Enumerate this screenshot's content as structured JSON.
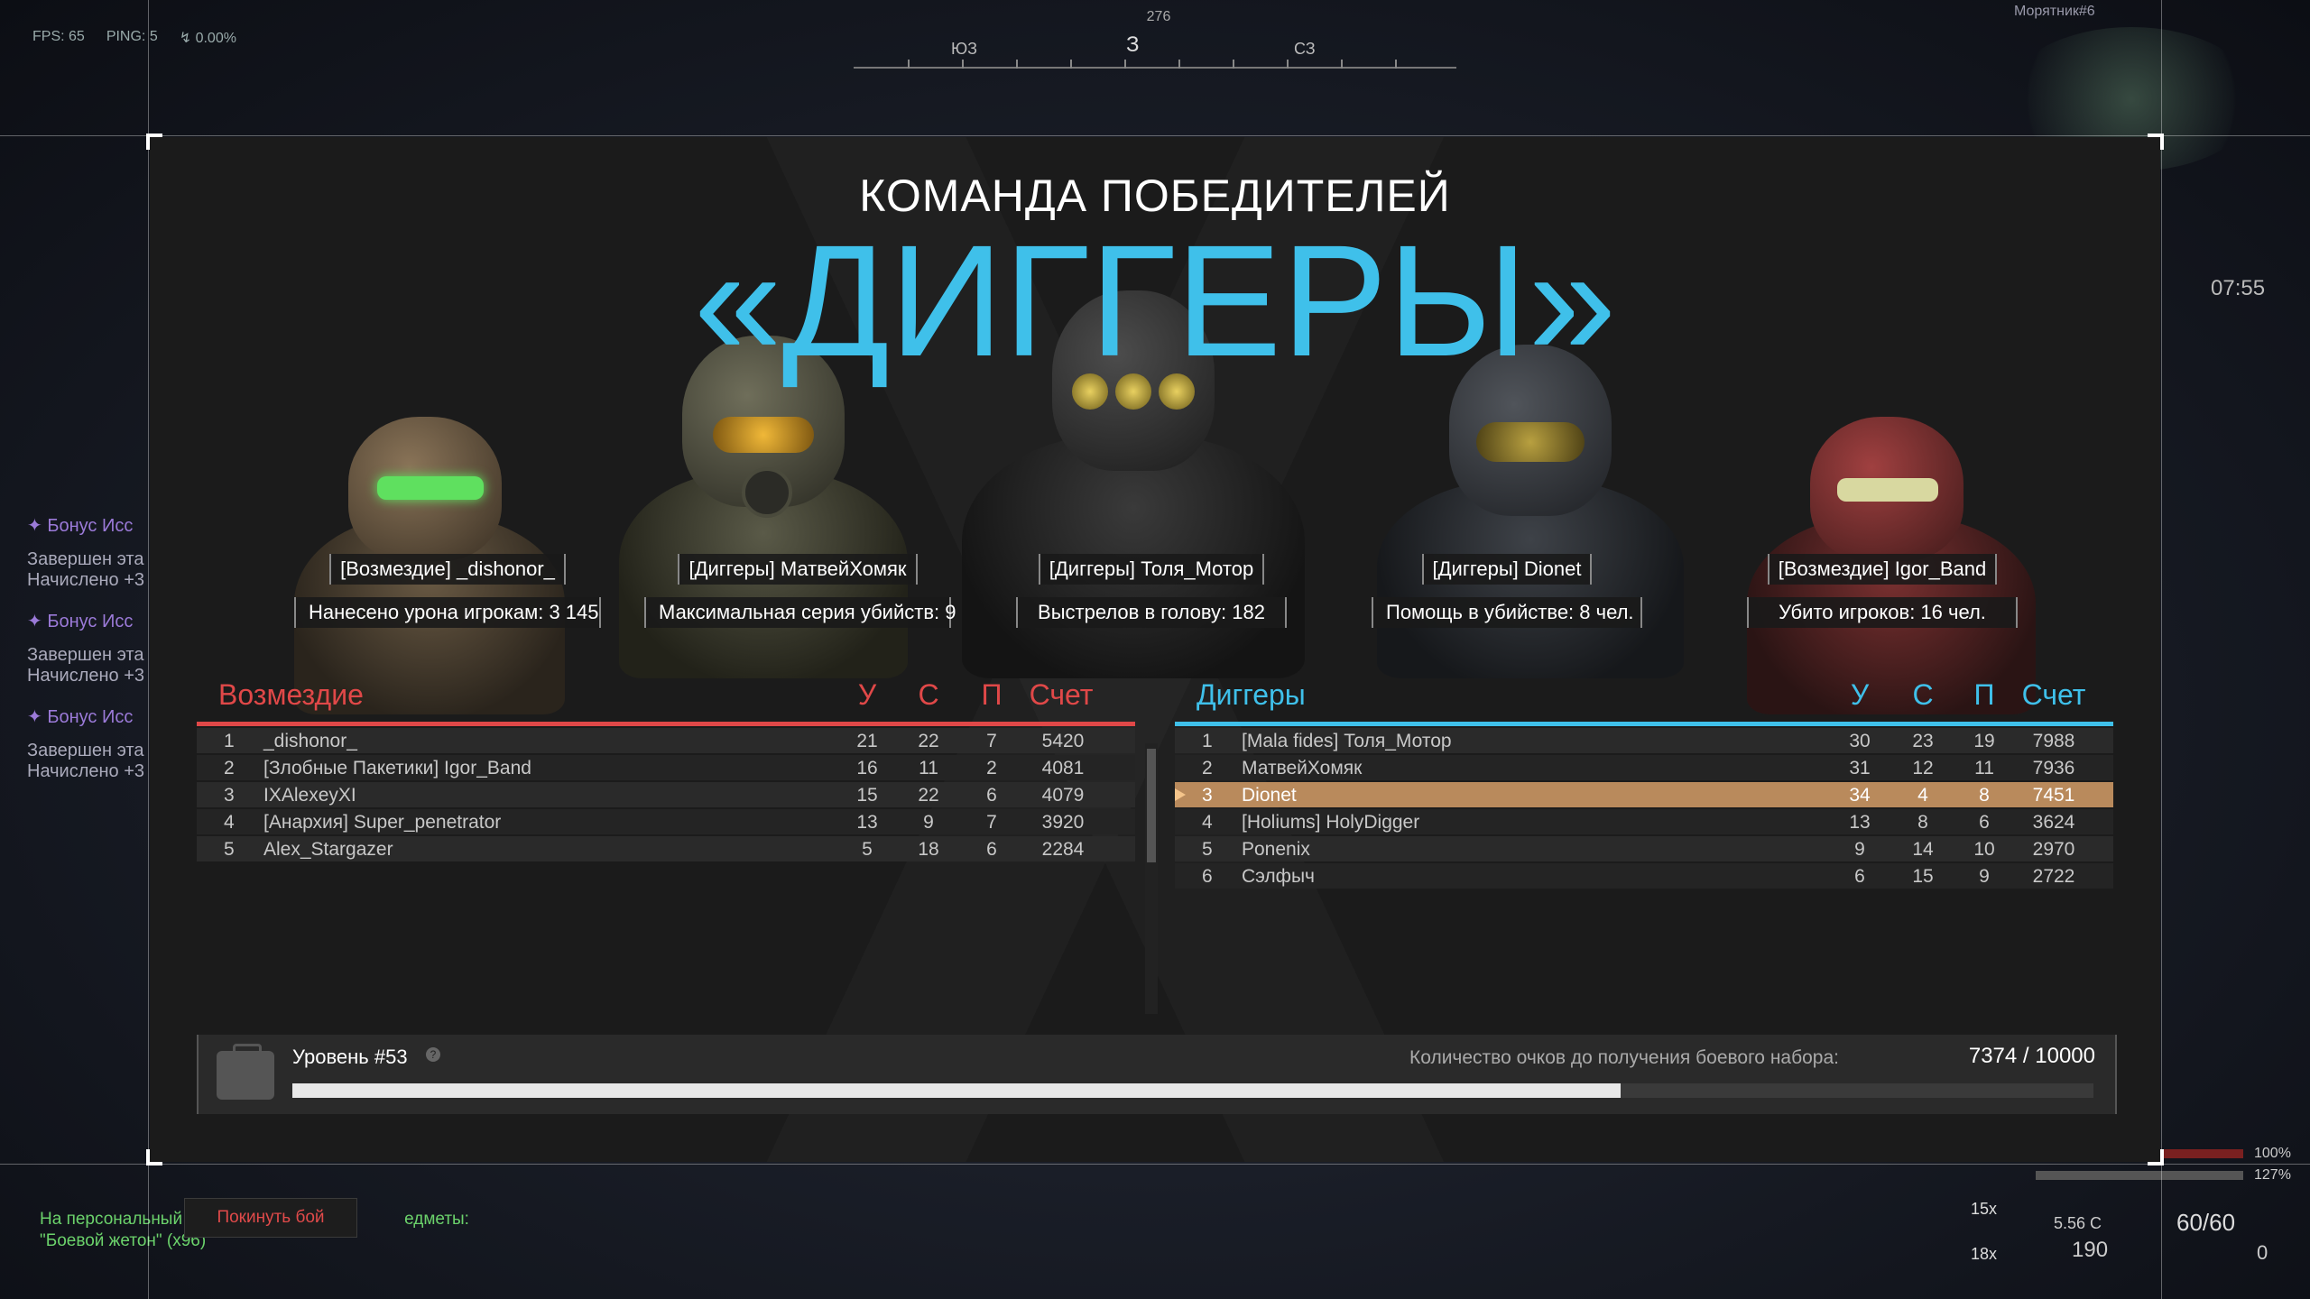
{
  "hud": {
    "fps": "FPS: 65",
    "ping": "PING: 5",
    "loss": "↯ 0.00%",
    "compass": {
      "bearing": "276",
      "main": "З",
      "left": "ЮЗ",
      "right": "СЗ"
    },
    "player_tag": "Морятник#6",
    "clock": "07:55",
    "feed": [
      {
        "bonus": "Бонус Исс",
        "line1": "Завершен эта",
        "line2": "Начислено +3"
      },
      {
        "bonus": "Бонус Исс",
        "line1": "Завершен эта",
        "line2": "Начислено +3"
      },
      {
        "bonus": "Бонус Исс",
        "line1": "Завершен эта",
        "line2": "Начислено +3"
      }
    ],
    "bottom_left": {
      "line1a": "На персональный",
      "line1b": "едметы:",
      "line2": "\"Боевой жетон\" (x96)"
    },
    "leave_button": "Покинуть бой",
    "health": "100%",
    "armor": "127%",
    "ammo": "60/60",
    "grenades": "0",
    "caliber": "5.56 С",
    "reserve": "190",
    "scope1": "15x",
    "scope2": "18x"
  },
  "winner": {
    "title": "КОМАНДА ПОБЕДИТЕЛЕЙ",
    "team": "«ДИГГЕРЫ»"
  },
  "awards": [
    {
      "player": "[Возмездие] _dishonor_",
      "stat": "Нанесено урона игрокам: 3 145"
    },
    {
      "player": "[Диггеры] МатвейХомяк",
      "stat": "Максимальная серия убийств: 9"
    },
    {
      "player": "[Диггеры] Толя_Мотор",
      "stat": "Выстрелов в голову: 182"
    },
    {
      "player": "[Диггеры] Dionet",
      "stat": "Помощь в убийстве: 8 чел."
    },
    {
      "player": "[Возмездие] Igor_Band",
      "stat": "Убито игроков: 16 чел."
    }
  ],
  "teams": {
    "left": {
      "name": "Возмездие",
      "color": "#e04848",
      "cols": [
        "У",
        "С",
        "П",
        "Счет"
      ],
      "rows": [
        {
          "n": "1",
          "player": "_dishonor_",
          "k": "21",
          "d": "22",
          "a": "7",
          "score": "5420"
        },
        {
          "n": "2",
          "player": "[Злобные Пакетики] Igor_Band",
          "k": "16",
          "d": "11",
          "a": "2",
          "score": "4081"
        },
        {
          "n": "3",
          "player": "IXAlexeyXI",
          "k": "15",
          "d": "22",
          "a": "6",
          "score": "4079"
        },
        {
          "n": "4",
          "player": "[Анархия] Super_penetrator",
          "k": "13",
          "d": "9",
          "a": "7",
          "score": "3920"
        },
        {
          "n": "5",
          "player": "Alex_Stargazer",
          "k": "5",
          "d": "18",
          "a": "6",
          "score": "2284"
        }
      ]
    },
    "right": {
      "name": "Диггеры",
      "color": "#3fc0ea",
      "cols": [
        "У",
        "С",
        "П",
        "Счет"
      ],
      "rows": [
        {
          "n": "1",
          "player": "[Mala fides] Толя_Мотор",
          "k": "30",
          "d": "23",
          "a": "19",
          "score": "7988"
        },
        {
          "n": "2",
          "player": "МатвейХомяк",
          "k": "31",
          "d": "12",
          "a": "11",
          "score": "7936"
        },
        {
          "n": "3",
          "player": "Dionet",
          "k": "34",
          "d": "4",
          "a": "8",
          "score": "7451",
          "me": true
        },
        {
          "n": "4",
          "player": "[Holiums] HolyDigger",
          "k": "13",
          "d": "8",
          "a": "6",
          "score": "3624"
        },
        {
          "n": "5",
          "player": "Ponenix",
          "k": "9",
          "d": "14",
          "a": "10",
          "score": "2970"
        },
        {
          "n": "6",
          "player": "Сэлфыч",
          "k": "6",
          "d": "15",
          "a": "9",
          "score": "2722"
        }
      ]
    }
  },
  "level": {
    "label": "Уровень #53",
    "info_icon": "?",
    "requirement": "Количество очков до получения боевого набора:",
    "points": "7374 / 10000",
    "progress": 0.7374
  }
}
